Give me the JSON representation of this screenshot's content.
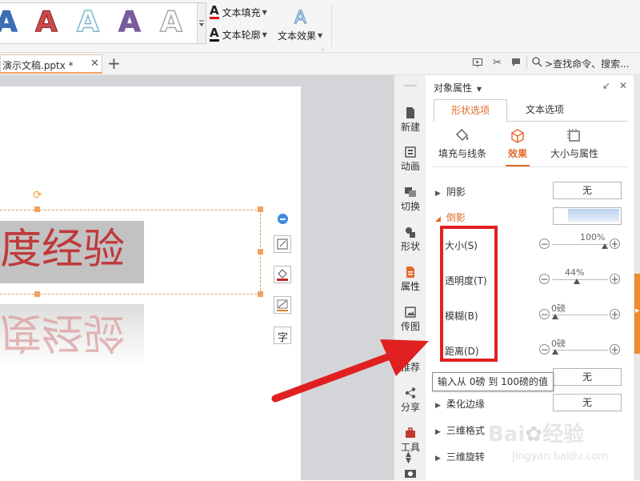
{
  "ribbon": {
    "text_fill_label": "文本填充",
    "text_outline_label": "文本轮廓",
    "text_effect_label": "文本效果",
    "art_letter": "A",
    "art_samples": [
      {
        "color": "#3a6fb5"
      },
      {
        "color": "#c84a4a"
      },
      {
        "color": "#7ab9c9"
      },
      {
        "color": "#7a5b9e"
      },
      {
        "color": "#a8a8a8"
      }
    ]
  },
  "tabbar": {
    "doc_tab_label": "演示文稿.pptx *",
    "search_label": "查找命令、搜索..."
  },
  "slide": {
    "text": "度经验",
    "reflection_text": "度经验",
    "text_color": "#c0393b"
  },
  "strip": {
    "items": [
      {
        "label": "新建",
        "icon": "new-file-icon"
      },
      {
        "label": "动画",
        "icon": "animation-icon"
      },
      {
        "label": "切换",
        "icon": "transition-icon"
      },
      {
        "label": "形状",
        "icon": "shape-icon"
      },
      {
        "label": "属性",
        "icon": "property-icon"
      },
      {
        "label": "传图",
        "icon": "upload-image-icon"
      },
      {
        "label": "推荐",
        "icon": "recommend-icon"
      },
      {
        "label": "分享",
        "icon": "share-icon"
      },
      {
        "label": "工具",
        "icon": "toolbox-icon"
      }
    ]
  },
  "panel": {
    "title": "对象属性",
    "tabs": {
      "shape": "形状选项",
      "text": "文本选项"
    },
    "subtabs": {
      "fill_line": "填充与线条",
      "effect": "效果",
      "size_props": "大小与属性"
    },
    "shadow": {
      "label": "阴影",
      "value": "无"
    },
    "reflection": {
      "label": "倒影",
      "size": {
        "label": "大小(S)",
        "value": "100%",
        "level": 1.0
      },
      "transparency": {
        "label": "透明度(T)",
        "value": "44%",
        "level": 0.44
      },
      "blur": {
        "label": "模糊(B)",
        "value": "0磅",
        "level": 0.0
      },
      "distance": {
        "label": "距离(D)",
        "value": "0磅",
        "level": 0.0
      }
    },
    "glow": {
      "value": "无"
    },
    "soft_edge": {
      "label": "柔化边缘",
      "value": "无"
    },
    "format_3d": {
      "label": "三维格式"
    },
    "rotation_3d": {
      "label": "三维旋转"
    },
    "tooltip": "输入从 0磅 到 100磅的值"
  },
  "watermark": {
    "brand": "Bai",
    "brand_suffix": "经验",
    "url": "jingyan.baidu.com"
  },
  "colors": {
    "accent": "#e26b2a",
    "annotation": "#e02020"
  }
}
